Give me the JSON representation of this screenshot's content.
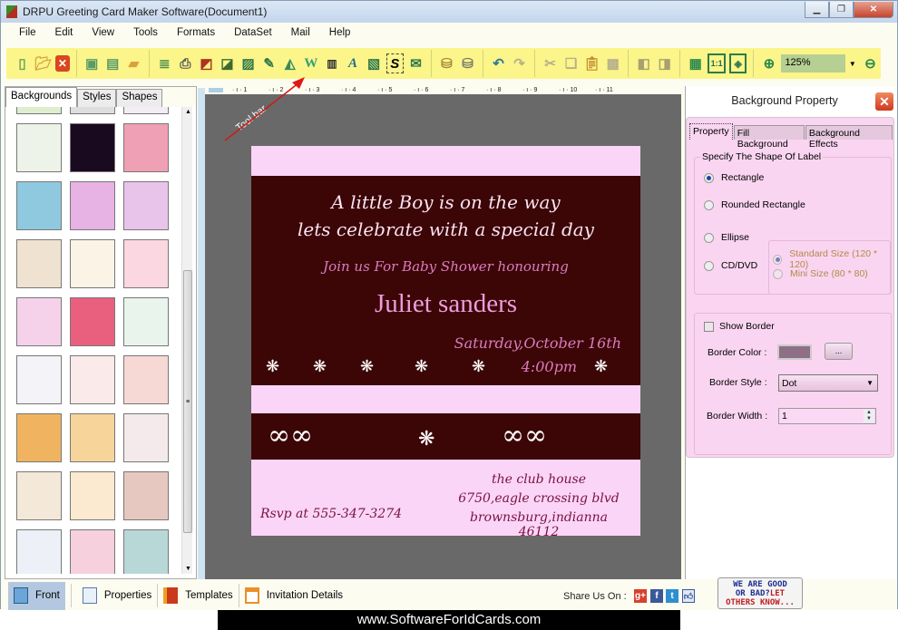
{
  "window": {
    "title": "DRPU Greeting Card Maker Software(Document1)",
    "controls": [
      "minimize",
      "restore",
      "close"
    ]
  },
  "menu": [
    "File",
    "Edit",
    "View",
    "Tools",
    "Formats",
    "DataSet",
    "Mail",
    "Help"
  ],
  "toolbar": {
    "groups": [
      [
        "new-icon",
        "open-icon",
        "close-document-icon"
      ],
      [
        "save-icon",
        "save-as-icon",
        "open-folder-icon"
      ],
      [
        "properties-icon",
        "print-icon",
        "layers-icon",
        "crop-icon",
        "insert-image-icon",
        "pen-icon",
        "shapes-icon",
        "wordart-icon",
        "barcode-icon",
        "text-icon",
        "label-icon",
        "signature-icon",
        "mail-icon"
      ],
      [
        "database-add-icon",
        "database-icon"
      ],
      [
        "undo-icon",
        "redo-icon"
      ],
      [
        "cut-icon",
        "copy-icon",
        "paste-icon",
        "delete-icon"
      ],
      [
        "bring-forward-icon",
        "send-backward-icon"
      ],
      [
        "grid-icon",
        "actual-size-icon",
        "fit-window-icon"
      ]
    ],
    "zoom_value": "125%"
  },
  "left_panel": {
    "tabs": [
      "Backgrounds",
      "Styles",
      "Shapes"
    ],
    "active_tab": "Backgrounds",
    "thumbnails": [
      "leaves-strip",
      "gray-strip",
      "dots-strip",
      "green-hearts",
      "fireworks",
      "red-hearts",
      "christmas-santa",
      "pink-flowers",
      "purple-flowers",
      "pastel-stripes",
      "teddy-bear",
      "pink-dress",
      "hearts-butterflies",
      "heart-frame-bears",
      "bunnies",
      "kids-rainbow",
      "ribbon-hearts",
      "red-clover",
      "butterflies",
      "teddy-card",
      "pink-floral",
      "daisies",
      "party-gifts",
      "cherries",
      "stars",
      "pink-texture",
      "snowmen"
    ]
  },
  "ruler": {
    "marks": [
      "1",
      "2",
      "3",
      "4",
      "5",
      "6",
      "7",
      "8",
      "9",
      "10",
      "11"
    ]
  },
  "annotation": {
    "label": "Tool bar"
  },
  "card": {
    "line1": "A little Boy is on the way",
    "line2": "lets celebrate with a special day",
    "line3": "Join us For Baby Shower honouring",
    "name": "Juliet sanders",
    "date": "Saturday,October 16th",
    "time": "4:00pm",
    "venue1": "the club house",
    "venue2": "6750,eagle crossing blvd",
    "venue3": "brownsburg,indianna 46112",
    "rsvp": "Rsvp at 555-347-3274",
    "colors": {
      "pink": "#fad5f7",
      "maroon": "#3c0506"
    }
  },
  "right_panel": {
    "title": "Background Property",
    "tabs": [
      "Property",
      "Fill Background",
      "Background Effects"
    ],
    "active_tab": "Property",
    "shape_group_label": "Specify The Shape Of Label",
    "shapes": [
      {
        "label": "Rectangle",
        "selected": true
      },
      {
        "label": "Rounded Rectangle",
        "selected": false
      },
      {
        "label": "Ellipse",
        "selected": false
      },
      {
        "label": "CD/DVD",
        "selected": false
      }
    ],
    "sizes": [
      {
        "label": "Standard Size (120 * 120)",
        "selected": true,
        "disabled": true
      },
      {
        "label": "Mini Size (80 * 80)",
        "selected": false,
        "disabled": true
      }
    ],
    "show_border_label": "Show Border",
    "show_border_checked": false,
    "border_color_label": "Border Color :",
    "border_color": "#8f6f86",
    "border_color_button": "...",
    "border_style_label": "Border Style :",
    "border_style_value": "Dot",
    "border_width_label": "Border Width :",
    "border_width_value": "1"
  },
  "bottom_bar": {
    "buttons": [
      "Front",
      "Properties",
      "Templates",
      "Invitation Details"
    ],
    "active": "Front",
    "share_label": "Share Us On :",
    "social": [
      "google-plus",
      "facebook",
      "twitter",
      "like"
    ],
    "rate_line1": "WE ARE GOOD",
    "rate_line2a": "OR BAD?",
    "rate_line2b": "LET",
    "rate_line3": "OTHERS KNOW..."
  },
  "footer": {
    "url": "www.SoftwareForIdCards.com"
  }
}
